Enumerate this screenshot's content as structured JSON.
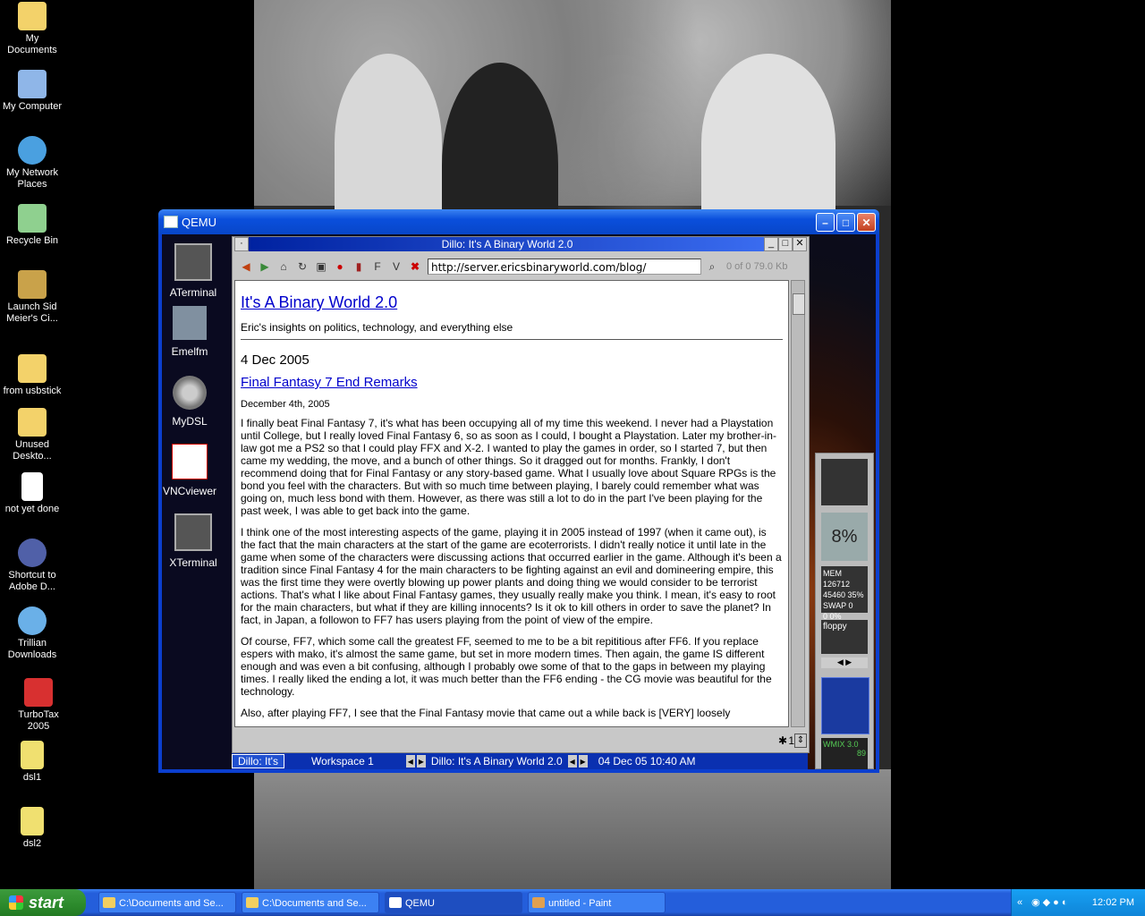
{
  "desktop": {
    "icons": [
      {
        "label": "My Documents"
      },
      {
        "label": "My Computer"
      },
      {
        "label": "My Network Places"
      },
      {
        "label": "Recycle Bin"
      },
      {
        "label": "Launch Sid Meier's Ci..."
      },
      {
        "label": "from usbstick"
      },
      {
        "label": "Unused Deskto..."
      },
      {
        "label": "not yet done"
      },
      {
        "label": "Shortcut to Adobe D..."
      },
      {
        "label": "Trillian Downloads"
      },
      {
        "label": "TurboTax 2005"
      },
      {
        "label": "dsl1"
      },
      {
        "label": "dsl2"
      }
    ]
  },
  "qemu": {
    "title": "QEMU",
    "min_label": "–",
    "max_label": "□",
    "close_label": "✕",
    "dsl_icons": [
      {
        "label": "ATerminal"
      },
      {
        "label": "Emelfm"
      },
      {
        "label": "MyDSL"
      },
      {
        "label": "VNCviewer"
      },
      {
        "label": "XTerminal"
      }
    ]
  },
  "dillo": {
    "title": "Dillo: It's A Binary World 2.0",
    "url": "http://server.ericsbinaryworld.com/blog/",
    "progress": "0 of 0  79.0 Kb",
    "page": {
      "site_title": "It's A Binary World 2.0",
      "tagline": "Eric's insights on politics, technology, and everything else",
      "date": "4 Dec 2005",
      "post_title": "Final Fantasy 7 End Remarks",
      "posted": "December 4th, 2005",
      "paragraphs": [
        "I finally beat Final Fantasy 7, it's what has been occupying all of my time this weekend. I never had a Playstation until College, but I really loved Final Fantasy 6, so as soon as I could, I bought a Playstation. Later my brother-in-law got me a PS2 so that I could play FFX and X-2. I wanted to play the games in order, so I started 7, but then came my wedding, the move, and a bunch of other things. So it dragged out for months. Frankly, I don't recommend doing that for Final Fantasy or any story-based game. What I usually love about Square RPGs is the bond you feel with the characters. But with so much time between playing, I barely could remember what was going on, much less bond with them. However, as there was still a lot to do in the part I've been playing for the past week, I was able to get back into the game.",
        "I think one of the most interesting aspects of the game, playing it in 2005 instead of 1997 (when it came out), is the fact that the main characters at the start of the game are ecoterrorists. I didn't really notice it until late in the game when some of the characters were discussing actions that occurred earlier in the game. Although it's been a tradition since Final Fantasy 4 for the main characters to be fighting against an evil and domineering empire, this was the first time they were overtly blowing up power plants and doing thing we would consider to be terrorist actions. That's what I like about Final Fantasy games, they usually really make you think. I mean, it's easy to root for the main characters, but what if they are killing innocents? Is it ok to kill others in order to save the planet? In fact, in Japan, a followon to FF7 has users playing from the point of view of the empire.",
        "Of course, FF7, which some call the greatest FF, seemed to me to be a bit repititious after FF6. If you replace espers with mako, it's almost the same game, but set in more modern times. Then again, the game IS different enough and was even a bit confusing, although I probably owe some of that to the gaps in between my playing times. I really liked the ending a lot, it was much better than the FF6 ending - the CG movie was beautiful for the technology.",
        "Also, after playing FF7, I see that the Final Fantasy movie that came out a while back is [VERY] loosely"
      ]
    },
    "status_count": "1"
  },
  "dsl_bar": {
    "app": "Dillo: It's",
    "workspace": "Workspace 1",
    "window": "Dillo: It's A Binary World 2.0",
    "datetime": "04 Dec 05 10:40 AM"
  },
  "dock": {
    "cpu": "8%",
    "mem": "MEM  126712",
    "mem2": "45460  35%",
    "swap": "SWAP      0",
    "swap2": "0          0%",
    "floppy": "floppy",
    "wmix": "WMIX 3.0",
    "wmix_val": "89"
  },
  "taskbar": {
    "start": "start",
    "tasks": [
      {
        "label": "C:\\Documents and Se..."
      },
      {
        "label": "C:\\Documents and Se..."
      },
      {
        "label": "QEMU"
      },
      {
        "label": "untitled - Paint"
      }
    ],
    "clock": "12:02 PM"
  },
  "colors": {
    "xp_blue": "#245edb",
    "start_green": "#2c8a2c",
    "link": "#0000cc"
  }
}
